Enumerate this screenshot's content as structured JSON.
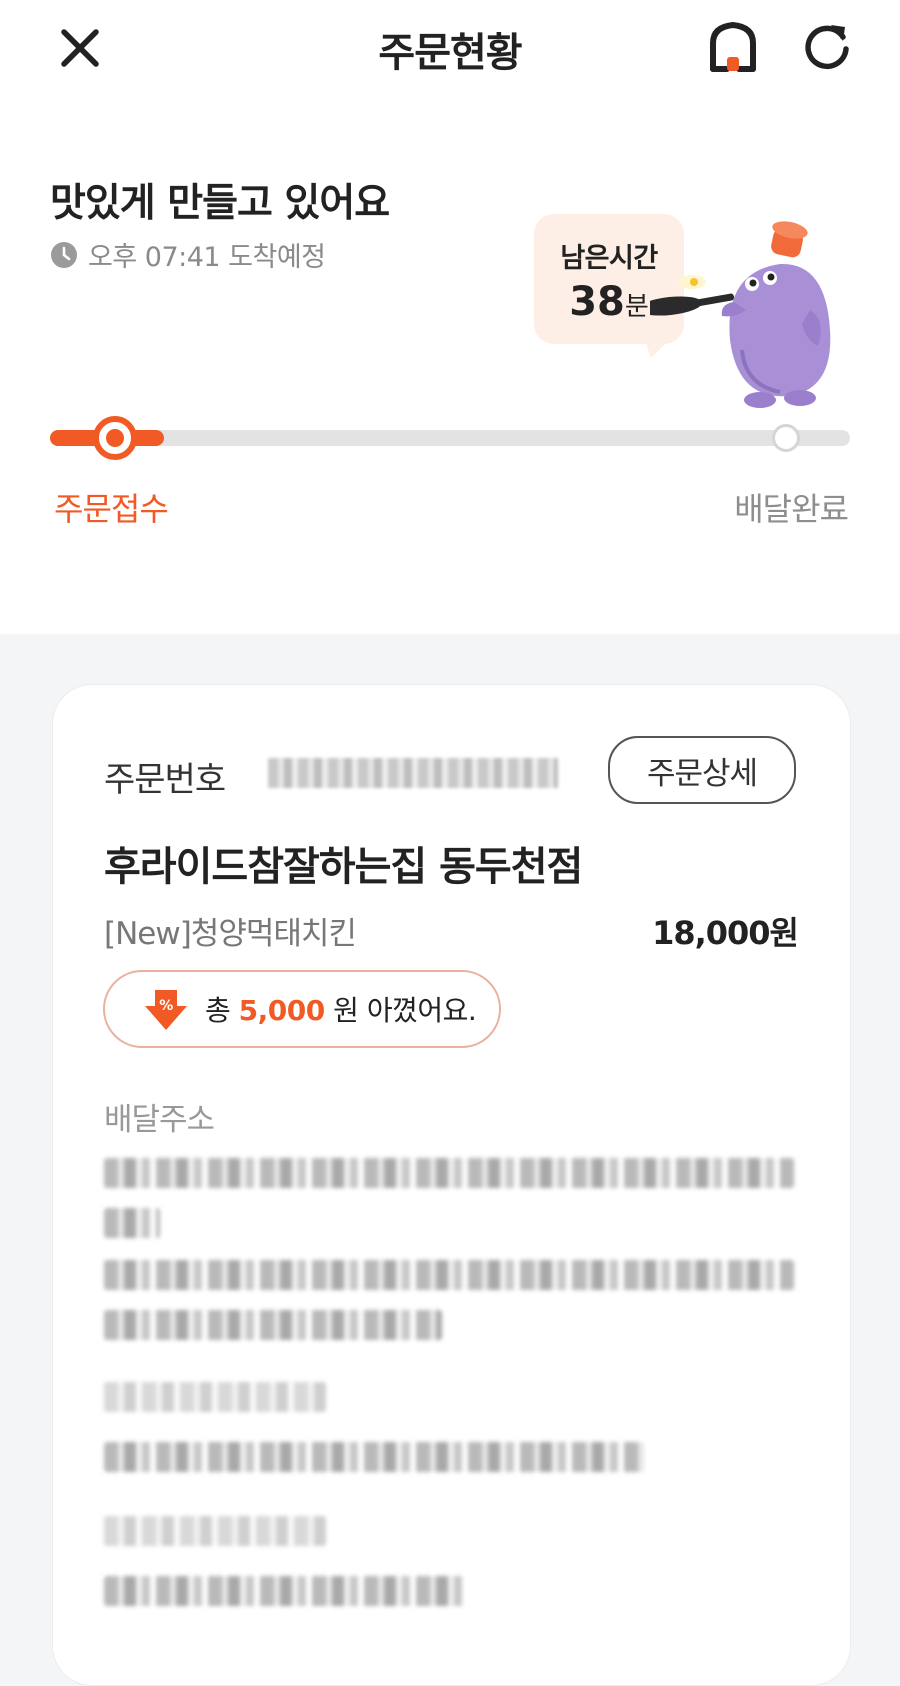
{
  "header": {
    "title": "주문현황",
    "close_icon": "close-icon",
    "home_icon": "home-icon",
    "refresh_icon": "refresh-icon"
  },
  "status": {
    "title": "맛있게 만들고 있어요",
    "eta": "오후 07:41 도착예정",
    "remaining_label": "남은시간",
    "remaining_value": "38",
    "remaining_unit": "분",
    "progress_fraction": 0.08,
    "step_start": "주문접수",
    "step_end": "배달완료",
    "accent_color": "#f15a24"
  },
  "order": {
    "number_label": "주문번호",
    "detail_button": "주문상세",
    "store_name": "후라이드참잘하는집 동두천점",
    "item_name": "[New]청양먹태치킨",
    "item_price": "18,000원",
    "savings_prefix": "총",
    "savings_amount": "5,000",
    "savings_suffix": "원 아꼈어요.",
    "address_label": "배달주소"
  }
}
